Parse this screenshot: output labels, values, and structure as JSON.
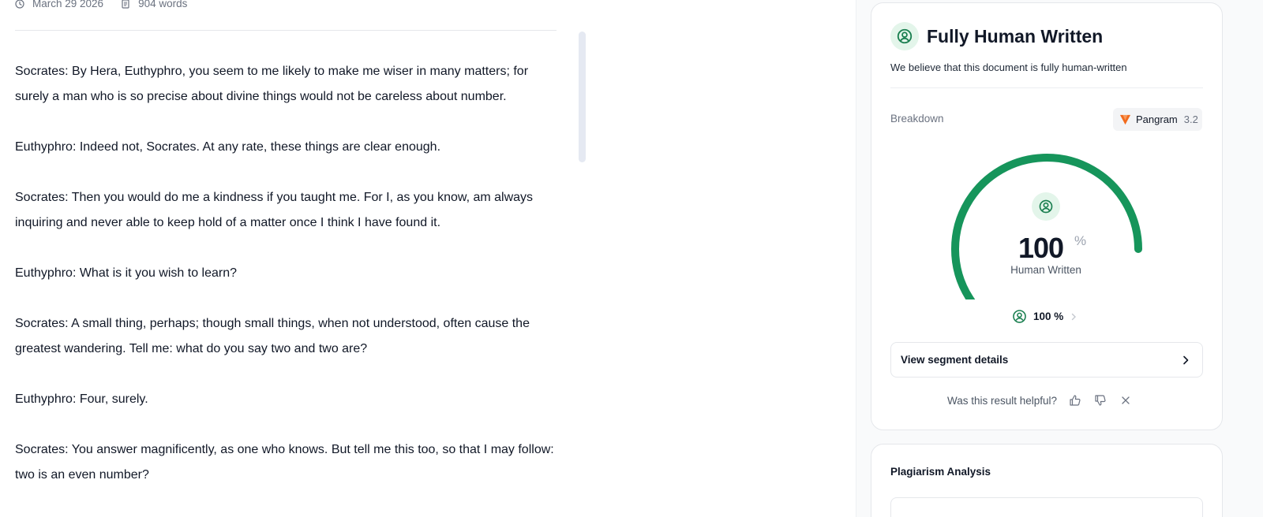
{
  "document": {
    "date": "March 29 2026",
    "word_count": "904 words",
    "paragraphs": [
      "Socrates: By Hera, Euthyphro, you seem to me likely to make me wiser in many matters; for surely a man who is so precise about divine things would not be careless about number.",
      "Euthyphro: Indeed not, Socrates. At any rate, these things are clear enough.",
      "Socrates: Then you would do me a kindness if you taught me. For I, as you know, am always inquiring and never able to keep hold of a matter once I think I have found it.",
      "Euthyphro: What is it you wish to learn?",
      "Socrates: A small thing, perhaps; though small things, when not understood, often cause the greatest wandering. Tell me: what do you say two and two are?",
      "Euthyphro: Four, surely.",
      "Socrates: You answer magnificently, as one who knows. But tell me this too, so that I may follow: two is an even number?"
    ]
  },
  "result": {
    "title": "Fully Human Written",
    "subtitle": "We believe that this document is fully human-written",
    "breakdown_label": "Breakdown",
    "model": {
      "name": "Pangram",
      "version": "3.2"
    },
    "gauge": {
      "value": "100",
      "unit": "%",
      "label": "Human Written",
      "fraction": 1.0
    },
    "human_percent": "100 %",
    "segment_button": "View segment details",
    "feedback_question": "Was this result helpful?"
  },
  "plagiarism": {
    "title": "Plagiarism Analysis"
  },
  "colors": {
    "accent_green": "#16955b",
    "badge_green_bg": "#e3f5ea",
    "pangram_orange": "#f26b1d"
  },
  "icons": {
    "date": "clock-icon",
    "words": "document-icon",
    "human": "person-circle-icon",
    "model": "pangram-logo-icon",
    "chevron": "chevron-right-icon",
    "thumbs_up": "thumbs-up-icon",
    "thumbs_down": "thumbs-down-icon",
    "dismiss": "close-icon"
  }
}
